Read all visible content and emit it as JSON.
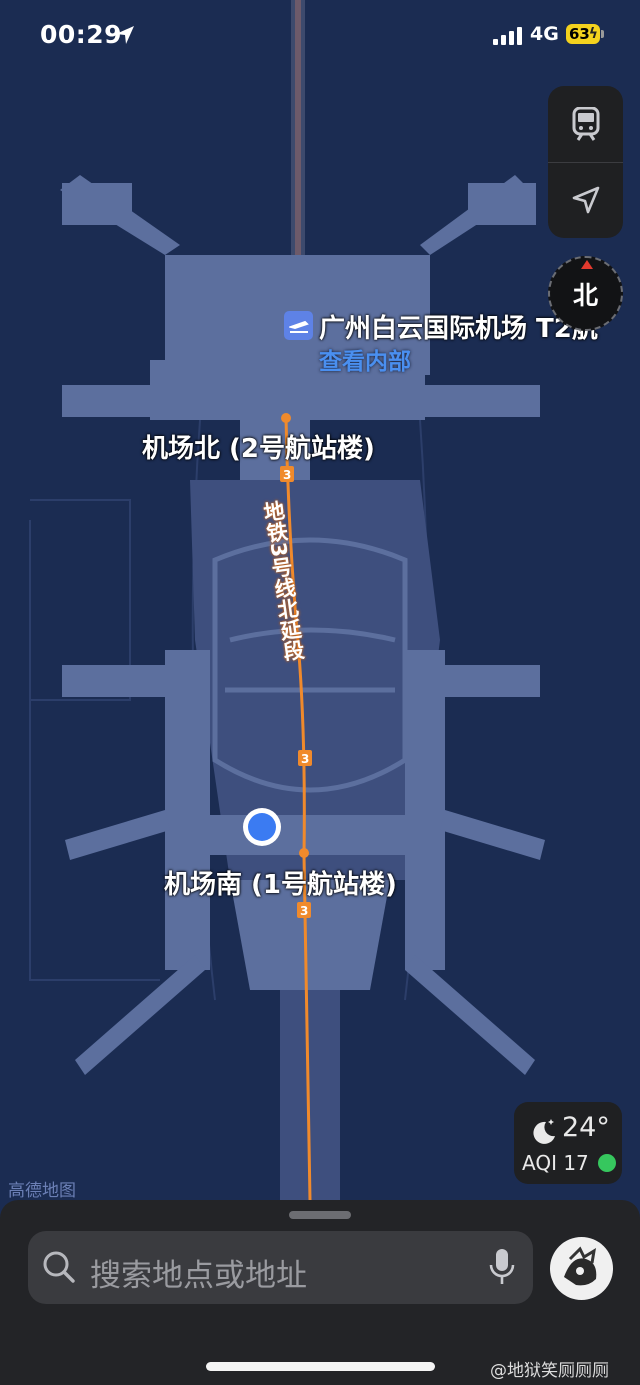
{
  "status_bar": {
    "time": "00:29",
    "network": "4G",
    "battery": "63"
  },
  "controls": {
    "transit_icon": "train-icon",
    "locate_icon": "navigation-arrow-icon",
    "compass_label": "北"
  },
  "map": {
    "poi": {
      "name": "广州白云国际机场 T2航",
      "sub_link": "查看内部"
    },
    "station_north": "机场北 (2号航站楼)",
    "station_south": "机场南 (1号航站楼)",
    "line_label": "地铁3号线北延段",
    "line_number": "3",
    "line_color": "#f08a2c",
    "attribution": "高德地图"
  },
  "weather": {
    "temperature": "24°",
    "aqi_label": "AQI 17",
    "aqi_status_color": "#36c75e"
  },
  "search": {
    "placeholder": "搜索地点或地址"
  },
  "watermark": "@地狱笑厕厕厕"
}
